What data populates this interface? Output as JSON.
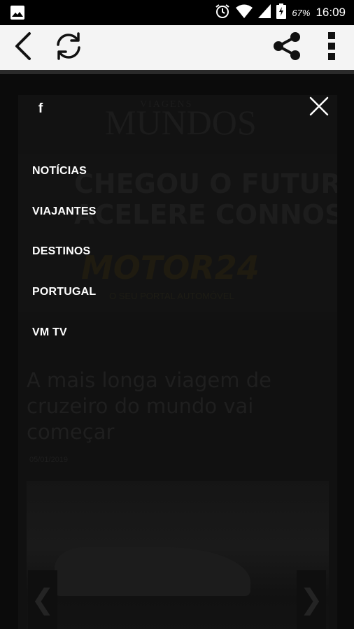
{
  "status_bar": {
    "battery_percent": "67%",
    "time": "16:09",
    "icons": [
      "image-notification-icon",
      "alarm-icon",
      "wifi-icon",
      "signal-icon",
      "battery-icon"
    ]
  },
  "toolbar": {
    "icons": [
      "back-icon",
      "refresh-icon",
      "share-icon",
      "more-vert-icon"
    ]
  },
  "drawer": {
    "social_icon": "facebook-icon",
    "facebook_label": "f",
    "close_icon": "close-icon",
    "menu": [
      {
        "label": "NOTÍCIAS"
      },
      {
        "label": "VIAJANTES"
      },
      {
        "label": "DESTINOS"
      },
      {
        "label": "PORTUGAL"
      },
      {
        "label": "VM TV"
      }
    ]
  },
  "background": {
    "logo": {
      "title": "MUNDOS",
      "superscript": "VIAGENS"
    },
    "ad": {
      "line1": "CHEGOU O FUTURO",
      "line2": "ACELERE CONNOSCO",
      "brand": "MOTOR24",
      "subline": "O SEU PORTAL AUTOMÓVEL"
    },
    "article": {
      "headline": "A mais longa viagem de cruzeiro do mundo vai começar",
      "date": "05/01/2019"
    },
    "carousel": {
      "prev_label": "❮",
      "next_label": "❯"
    }
  },
  "colors": {
    "status_bar": "#000000",
    "toolbar": "#f4f4f4",
    "overlay": "#0b0b0b",
    "menu_text": "#ffffff"
  }
}
